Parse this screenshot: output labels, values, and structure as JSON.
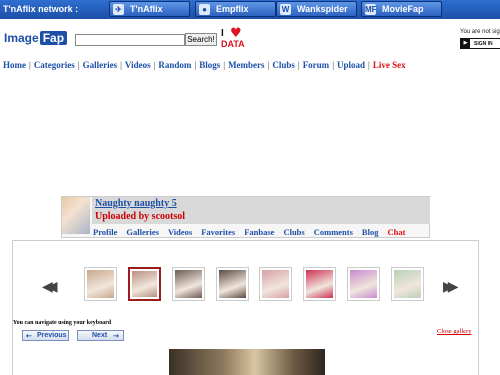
{
  "network": {
    "label": "T'nAflix network :",
    "sites": [
      {
        "icon": "tnaflix-icon",
        "glyph": "✈",
        "label": "T'nAflix"
      },
      {
        "icon": "empflix-icon",
        "glyph": "●",
        "label": "Empflix"
      },
      {
        "icon": "wankspider-icon",
        "glyph": "W",
        "label": "Wankspider"
      },
      {
        "icon": "moviefap-icon",
        "glyph": "MF",
        "label": "MovieFap"
      }
    ]
  },
  "header": {
    "logo_part1": "Image",
    "logo_part2": "Fap",
    "search_value": "",
    "search_button": "Search!",
    "data_logo_i": "I",
    "data_logo_heart": "♥",
    "data_logo_text": "DATA",
    "not_signed": "You are not sig",
    "sign_in": "SIGN IN"
  },
  "nav": {
    "items": [
      "Home",
      "Categories",
      "Galleries",
      "Videos",
      "Random",
      "Blogs",
      "Members",
      "Clubs",
      "Forum",
      "Upload"
    ],
    "live": "Live Sex",
    "separator": "|"
  },
  "gallery": {
    "title": "Naughty naughty 5",
    "uploader": "Uploaded by scootsol",
    "nav": [
      "Profile",
      "Galleries",
      "Videos",
      "Favorites",
      "Fanbase",
      "Clubs",
      "Comments",
      "Blog"
    ],
    "chat": "Chat"
  },
  "viewer": {
    "prev_arrow": "◀◀",
    "next_arrow": "▶▶",
    "thumb_colors": [
      "#c9a88a",
      "#b88f80",
      "#6b5a52",
      "#5b4a3f",
      "#d7a0a6",
      "#cc3355",
      "#c78bd0",
      "#b9d2b6"
    ],
    "selected_index": 1,
    "keyboard_note": "You can navigate using your keyboard",
    "previous_button": "Previous",
    "next_button": "Next",
    "close_gallery": "Close gallery"
  },
  "colors": {
    "brand_blue": "#1c4fa8",
    "accent_red": "#cc0000"
  }
}
